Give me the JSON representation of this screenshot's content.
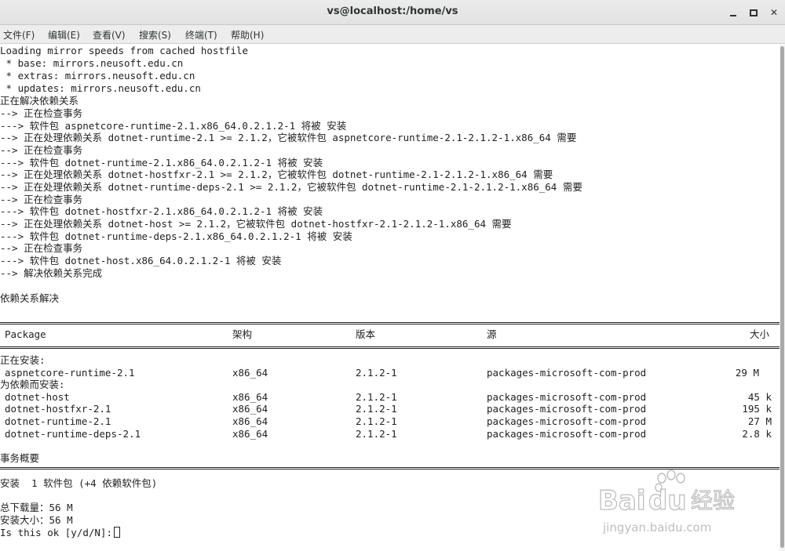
{
  "window": {
    "title": "vs@localhost:/home/vs"
  },
  "menu": {
    "items": [
      "文件(F)",
      "编辑(E)",
      "查看(V)",
      "搜索(S)",
      "终端(T)",
      "帮助(H)"
    ]
  },
  "terminal": {
    "lines": [
      "Loading mirror speeds from cached hostfile",
      " * base: mirrors.neusoft.edu.cn",
      " * extras: mirrors.neusoft.edu.cn",
      " * updates: mirrors.neusoft.edu.cn",
      "正在解决依赖关系",
      "--> 正在检查事务",
      "---> 软件包 aspnetcore-runtime-2.1.x86_64.0.2.1.2-1 将被 安装",
      "--> 正在处理依赖关系 dotnet-runtime-2.1 >= 2.1.2，它被软件包 aspnetcore-runtime-2.1-2.1.2-1.x86_64 需要",
      "--> 正在检查事务",
      "---> 软件包 dotnet-runtime-2.1.x86_64.0.2.1.2-1 将被 安装",
      "--> 正在处理依赖关系 dotnet-hostfxr-2.1 >= 2.1.2，它被软件包 dotnet-runtime-2.1-2.1.2-1.x86_64 需要",
      "--> 正在处理依赖关系 dotnet-runtime-deps-2.1 >= 2.1.2，它被软件包 dotnet-runtime-2.1-2.1.2-1.x86_64 需要",
      "--> 正在检查事务",
      "---> 软件包 dotnet-hostfxr-2.1.x86_64.0.2.1.2-1 将被 安装",
      "--> 正在处理依赖关系 dotnet-host >= 2.1.2，它被软件包 dotnet-hostfxr-2.1-2.1.2-1.x86_64 需要",
      "---> 软件包 dotnet-runtime-deps-2.1.x86_64.0.2.1.2-1 将被 安装",
      "--> 正在检查事务",
      "---> 软件包 dotnet-host.x86_64.0.2.1.2-1 将被 安装",
      "--> 解决依赖关系完成",
      "",
      "依赖关系解决"
    ],
    "table": {
      "headers": [
        "Package",
        "架构",
        "版本",
        "源",
        "大小"
      ],
      "installing_label": "正在安装:",
      "installing_rows": [
        [
          "aspnetcore-runtime-2.1",
          "x86_64",
          "2.1.2-1",
          "packages-microsoft-com-prod",
          "29 M"
        ]
      ],
      "dependency_label": "为依赖而安装:",
      "dependency_rows": [
        [
          "dotnet-host",
          "x86_64",
          "2.1.2-1",
          "packages-microsoft-com-prod",
          "45 k"
        ],
        [
          "dotnet-hostfxr-2.1",
          "x86_64",
          "2.1.2-1",
          "packages-microsoft-com-prod",
          "195 k"
        ],
        [
          "dotnet-runtime-2.1",
          "x86_64",
          "2.1.2-1",
          "packages-microsoft-com-prod",
          "27 M"
        ],
        [
          "dotnet-runtime-deps-2.1",
          "x86_64",
          "2.1.2-1",
          "packages-microsoft-com-prod",
          "2.8 k"
        ]
      ]
    },
    "summary_title": "事务概要",
    "summary_line": "安装  1 软件包 (+4 依赖软件包)",
    "download_size": "总下载量：56 M",
    "installed_size": "安装大小：56 M",
    "prompt": "Is this ok [y/d/N]:"
  },
  "watermark": {
    "brand": "Bai du 经验",
    "url": "jingyan.baidu.com"
  }
}
